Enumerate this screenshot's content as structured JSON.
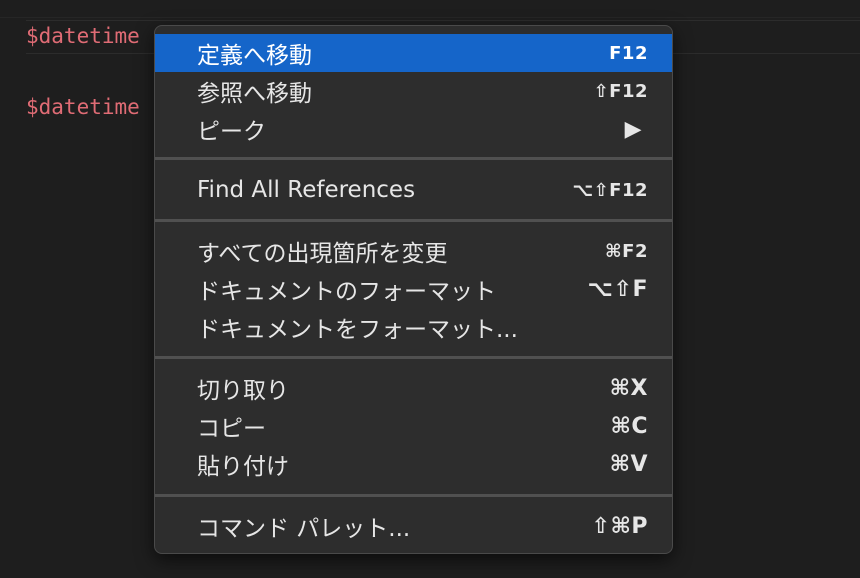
{
  "editor": {
    "lines": [
      "$datetime",
      "$datetime"
    ]
  },
  "menu": {
    "items": [
      {
        "label": "定義へ移動",
        "shortcut": "F12"
      },
      {
        "label": "参照へ移動",
        "shortcut": "⇧F12"
      },
      {
        "label": "ピーク",
        "shortcut": "▶"
      },
      {
        "label": "Find All References",
        "shortcut": "⌥⇧F12"
      },
      {
        "label": "すべての出現箇所を変更",
        "shortcut": "⌘F2"
      },
      {
        "label": "ドキュメントのフォーマット",
        "shortcut": "⌥⇧F"
      },
      {
        "label": "ドキュメントをフォーマット...",
        "shortcut": ""
      },
      {
        "label": "切り取り",
        "shortcut": "⌘X"
      },
      {
        "label": "コピー",
        "shortcut": "⌘C"
      },
      {
        "label": "貼り付け",
        "shortcut": "⌘V"
      },
      {
        "label": "コマンド パレット...",
        "shortcut": "⇧⌘P"
      }
    ]
  },
  "colors": {
    "background": "#1e1e1e",
    "menu_bg": "#2d2d2d",
    "highlight": "#1565c9",
    "code_text": "#e06c75"
  }
}
